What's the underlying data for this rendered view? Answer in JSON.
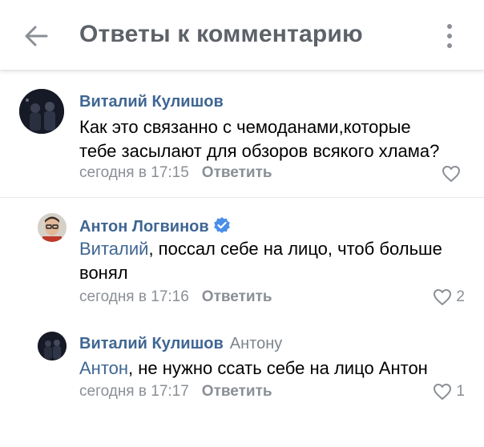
{
  "header": {
    "title": "Ответы к комментарию",
    "back_icon": "arrow-left-icon",
    "menu_icon": "more-vertical-icon"
  },
  "comments": [
    {
      "author": "Виталий Кулишов",
      "text_lines": [
        "Как это связанно с чемоданами,которые",
        "тебе засылают для обзоров всякого хлама?"
      ],
      "time": "сегодня в 17:15",
      "reply_label": "Ответить",
      "likes": ""
    },
    {
      "author": "Антон Логвинов",
      "verified": true,
      "mention": "Виталий",
      "text_after_mention": ", поссал себе на лицо, чтоб больше",
      "text_line2": "вонял",
      "time": "сегодня в 17:16",
      "reply_label": "Ответить",
      "likes": "2"
    },
    {
      "author": "Виталий Кулишов",
      "reply_to": "Антону",
      "mention": "Антон",
      "text_after_mention": ", не нужно ссать себе на лицо Антон",
      "time": "сегодня в 17:17",
      "reply_label": "Ответить",
      "likes": "1"
    }
  ],
  "colors": {
    "link_blue": "#3f6693",
    "secondary_gray": "#8a8f96",
    "title_gray": "#5d6168",
    "verified_blue": "#4a8ee8"
  }
}
